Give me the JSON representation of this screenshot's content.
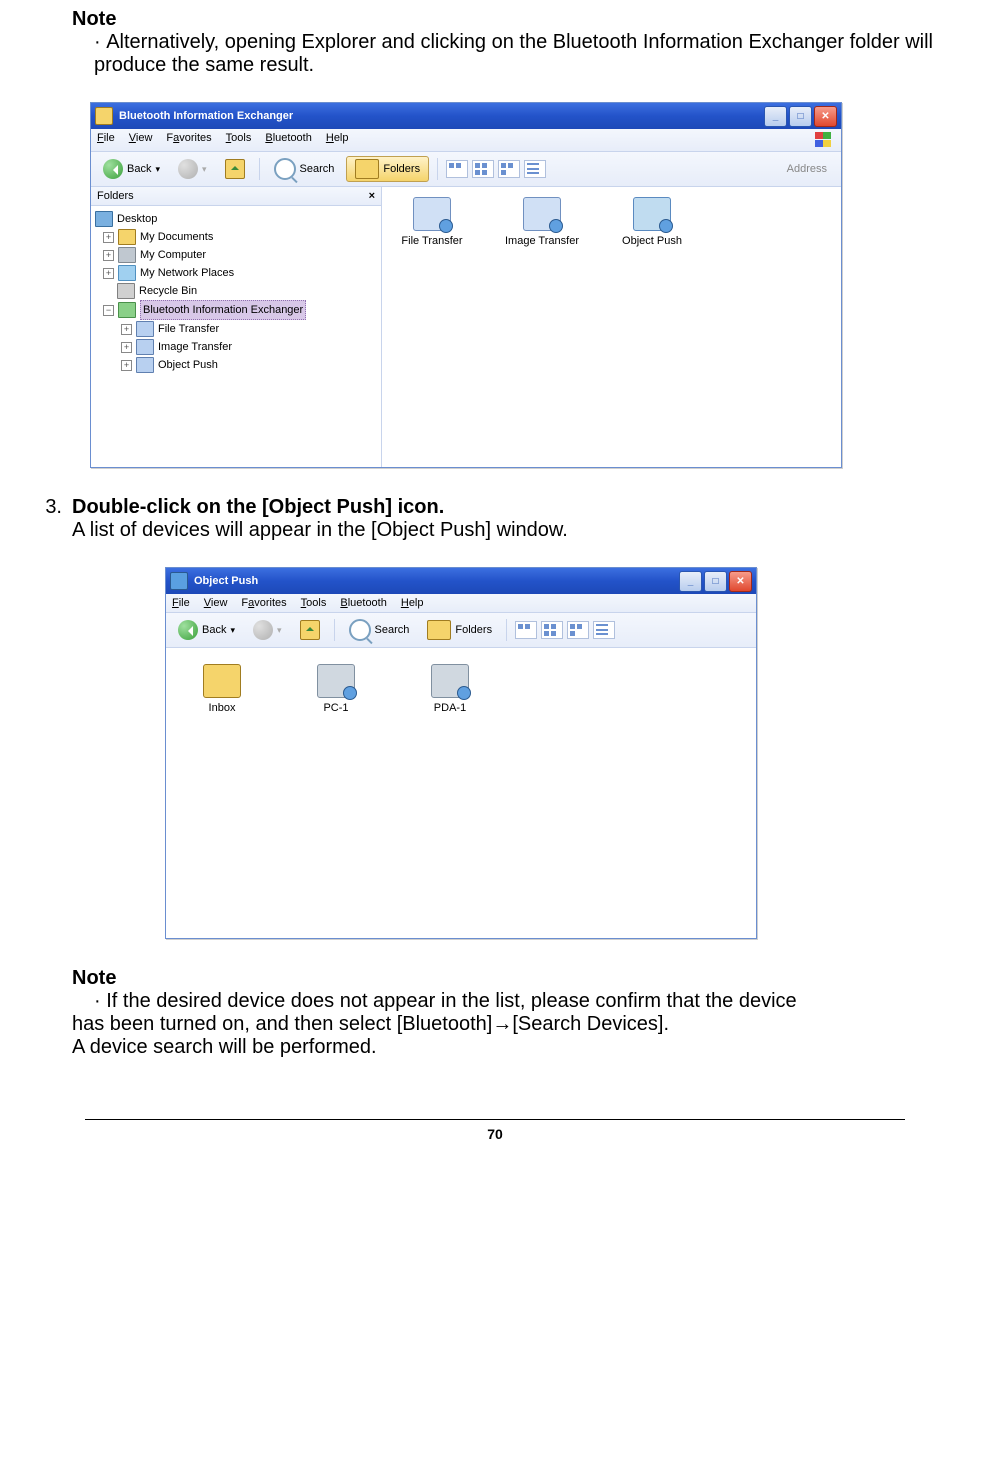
{
  "note1": {
    "label": "Note",
    "body": "Alternatively, opening Explorer and clicking on the Bluetooth Information Exchanger folder will produce the same result."
  },
  "win1": {
    "title": "Bluetooth Information Exchanger",
    "menu": {
      "file": "File",
      "view": "View",
      "fav": "Favorites",
      "tools": "Tools",
      "bt": "Bluetooth",
      "help": "Help"
    },
    "toolbar": {
      "back": "Back",
      "search": "Search",
      "folders": "Folders",
      "address": "Address"
    },
    "foldersHeader": "Folders",
    "tree": {
      "desktop": "Desktop",
      "mydocs": "My Documents",
      "mycomp": "My Computer",
      "mynet": "My Network Places",
      "recycle": "Recycle Bin",
      "btie": "Bluetooth Information Exchanger",
      "ft": "File Transfer",
      "it": "Image Transfer",
      "op": "Object Push"
    },
    "content": {
      "ft": "File Transfer",
      "it": "Image Transfer",
      "op": "Object Push"
    }
  },
  "step3": {
    "num": "3.",
    "title": "Double-click on the [Object Push] icon.",
    "body": "A list of devices will appear in the [Object Push] window."
  },
  "win2": {
    "title": "Object Push",
    "menu": {
      "file": "File",
      "view": "View",
      "fav": "Favorites",
      "tools": "Tools",
      "bt": "Bluetooth",
      "help": "Help"
    },
    "toolbar": {
      "back": "Back",
      "search": "Search",
      "folders": "Folders"
    },
    "content": {
      "inbox": "Inbox",
      "pc1": "PC-1",
      "pda1": "PDA-1"
    }
  },
  "note2": {
    "label": "Note",
    "line1": "If the desired device does not appear in the list, please confirm that the device",
    "line2": "has been turned on, and then select [Bluetooth]→[Search Devices].",
    "line3": "A device search will be performed."
  },
  "pageNumber": "70"
}
